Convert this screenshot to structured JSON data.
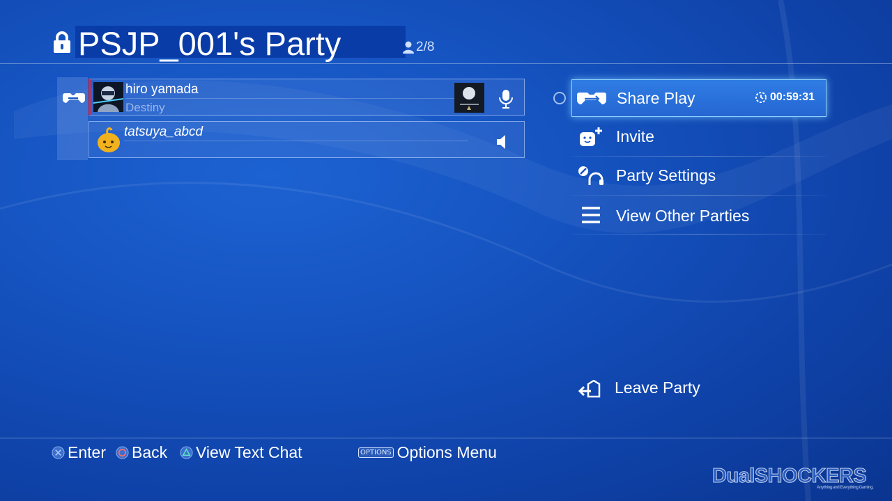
{
  "header": {
    "title": "PSJP_001's Party",
    "member_count": "2/8"
  },
  "members": [
    {
      "name": "hiro yamada",
      "game": "Destiny",
      "audio_icon": "microphone-icon"
    },
    {
      "name": "tatsuya_abcd",
      "game": "",
      "audio_icon": "speaker-icon"
    }
  ],
  "menu": {
    "items": [
      {
        "label": "Share Play",
        "icon": "share-play-icon",
        "timer": "00:59:31",
        "focused": true
      },
      {
        "label": "Invite",
        "icon": "invite-icon"
      },
      {
        "label": "Party Settings",
        "icon": "party-settings-icon"
      },
      {
        "label": "View Other Parties",
        "icon": "list-icon"
      }
    ],
    "leave_label": "Leave Party"
  },
  "footer": {
    "enter": "Enter",
    "back": "Back",
    "text_chat": "View Text Chat",
    "options_glyph": "OPTIONS",
    "options_menu": "Options Menu"
  },
  "watermark": {
    "text": "DualSHOCKERS",
    "tagline": "Anything and Everything Gaming."
  },
  "colors": {
    "accent": "#2a6fdc",
    "focus_border": "#8fd2ff",
    "host_marker": "#e0243a"
  }
}
